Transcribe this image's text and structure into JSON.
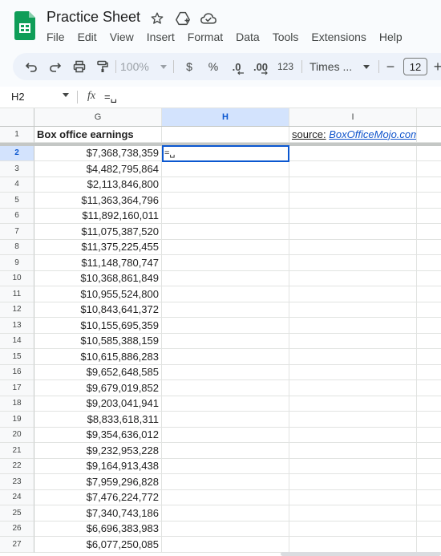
{
  "app": {
    "title": "Practice Sheet",
    "menu": [
      "File",
      "Edit",
      "View",
      "Insert",
      "Format",
      "Data",
      "Tools",
      "Extensions",
      "Help"
    ],
    "brand_color": "#0f9d58"
  },
  "toolbar": {
    "zoom": "100%",
    "currency": "$",
    "percent": "%",
    "decrease_decimal": ".0",
    "increase_decimal": ".00",
    "number_format": "123",
    "font": "Times ...",
    "font_size": "12",
    "minus": "−",
    "plus": "+"
  },
  "formula_bar": {
    "name_box": "H2",
    "fx": "fx",
    "content": "=␣"
  },
  "sheet": {
    "columns": [
      "G",
      "H",
      "I"
    ],
    "active_column": "H",
    "active_row": "2",
    "header_text": "Box office earnings",
    "source_label": "source:",
    "source_link": "BoxOfficeMojo.com",
    "editing_cell_text": "=␣",
    "rows": [
      {
        "num": "1",
        "g": "Box office earnings"
      },
      {
        "num": "2",
        "g": "$7,368,738,359"
      },
      {
        "num": "3",
        "g": "$4,482,795,864"
      },
      {
        "num": "4",
        "g": "$2,113,846,800"
      },
      {
        "num": "5",
        "g": "$11,363,364,796"
      },
      {
        "num": "6",
        "g": "$11,892,160,011"
      },
      {
        "num": "7",
        "g": "$11,075,387,520"
      },
      {
        "num": "8",
        "g": "$11,375,225,455"
      },
      {
        "num": "9",
        "g": "$11,148,780,747"
      },
      {
        "num": "10",
        "g": "$10,368,861,849"
      },
      {
        "num": "11",
        "g": "$10,955,524,800"
      },
      {
        "num": "12",
        "g": "$10,843,641,372"
      },
      {
        "num": "13",
        "g": "$10,155,695,359"
      },
      {
        "num": "14",
        "g": "$10,585,388,159"
      },
      {
        "num": "15",
        "g": "$10,615,886,283"
      },
      {
        "num": "16",
        "g": "$9,652,648,585"
      },
      {
        "num": "17",
        "g": "$9,679,019,852"
      },
      {
        "num": "18",
        "g": "$9,203,041,941"
      },
      {
        "num": "19",
        "g": "$8,833,618,311"
      },
      {
        "num": "20",
        "g": "$9,354,636,012"
      },
      {
        "num": "21",
        "g": "$9,232,953,228"
      },
      {
        "num": "22",
        "g": "$9,164,913,438"
      },
      {
        "num": "23",
        "g": "$7,959,296,828"
      },
      {
        "num": "24",
        "g": "$7,476,224,772"
      },
      {
        "num": "25",
        "g": "$7,340,743,186"
      },
      {
        "num": "26",
        "g": "$6,696,383,983"
      },
      {
        "num": "27",
        "g": "$6,077,250,085"
      }
    ]
  }
}
